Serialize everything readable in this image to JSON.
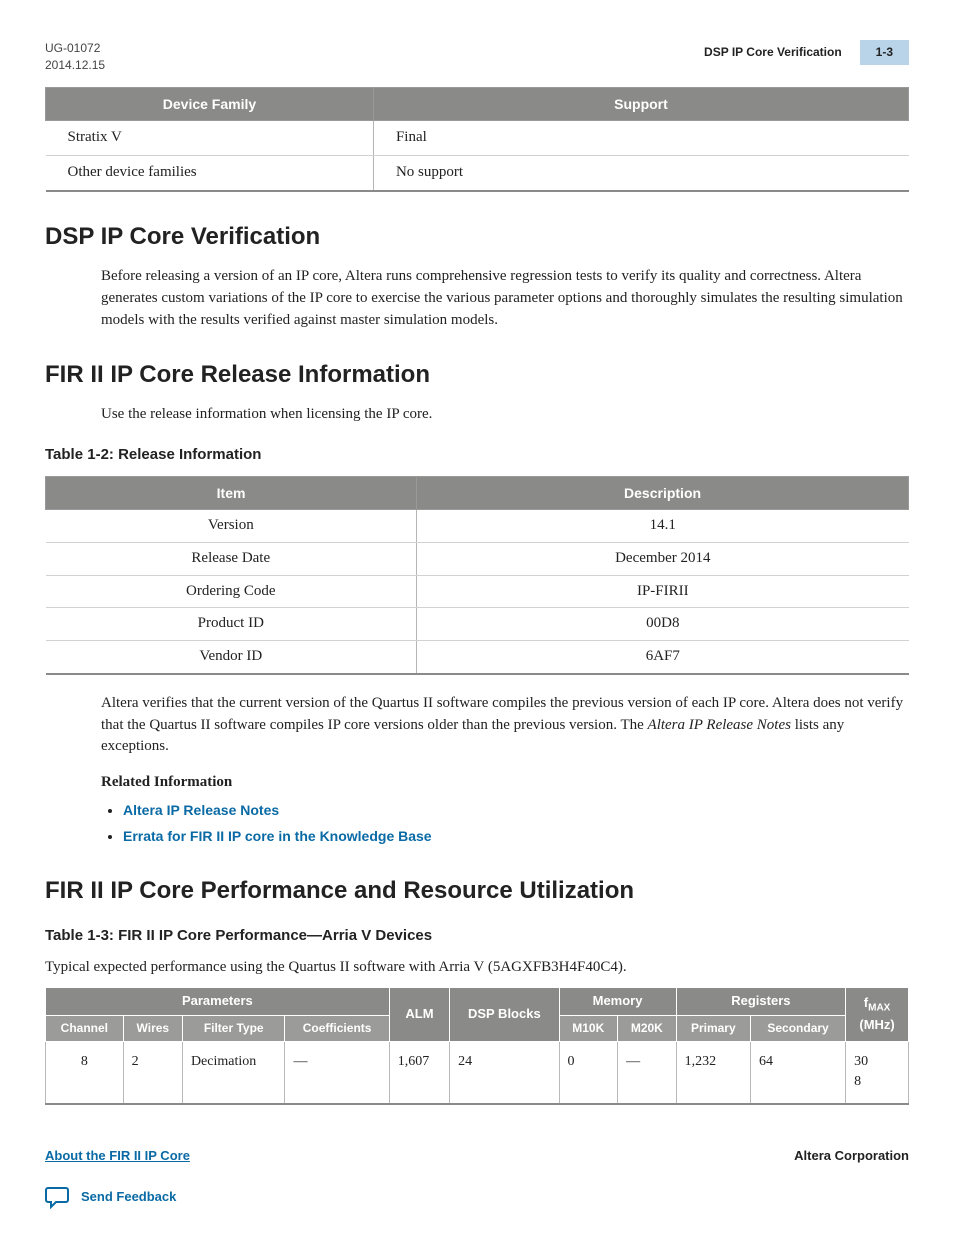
{
  "header": {
    "doc_id": "UG-01072",
    "date": "2014.12.15",
    "running_title": "DSP IP Core Verification",
    "page_num": "1-3"
  },
  "device_support_table": {
    "headers": [
      "Device Family",
      "Support"
    ],
    "rows": [
      {
        "family": "Stratix V",
        "support": "Final"
      },
      {
        "family": "Other device families",
        "support": "No support"
      }
    ]
  },
  "sections": {
    "verification": {
      "title": "DSP IP Core Verification",
      "body": "Before releasing a version of an IP core, Altera runs comprehensive regression tests to verify its quality and correctness. Altera generates custom variations of the IP core to exercise the various parameter options and thoroughly simulates the resulting simulation models with the results verified against master simulation models."
    },
    "release": {
      "title": "FIR II IP Core Release Information",
      "intro": "Use the release information when licensing the IP core.",
      "caption": "Table 1-2: Release Information",
      "headers": [
        "Item",
        "Description"
      ],
      "rows": [
        {
          "item": "Version",
          "desc": "14.1"
        },
        {
          "item": "Release Date",
          "desc": "December 2014"
        },
        {
          "item": "Ordering Code",
          "desc": "IP-FIRII"
        },
        {
          "item": "Product ID",
          "desc": "00D8"
        },
        {
          "item": "Vendor ID",
          "desc": "6AF7"
        }
      ],
      "after_para_1": "Altera verifies that the current version of the Quartus II software compiles the previous version of each IP core. Altera does not verify that the Quartus II software compiles IP core versions older than the previous version. The ",
      "after_para_em": "Altera IP Release Notes",
      "after_para_2": " lists any exceptions.",
      "related_heading": "Related Information",
      "related_links": [
        "Altera IP Release Notes",
        "Errata for FIR II IP core in the Knowledge Base"
      ]
    },
    "performance": {
      "title": "FIR II IP Core Performance and Resource Utilization",
      "caption": "Table 1-3: FIR II IP Core Performance—Arria V Devices",
      "desc": "Typical expected performance using the Quartus II software with Arria V (5AGXFB3H4F40C4).",
      "group_headers": {
        "parameters": "Parameters",
        "alm": "ALM",
        "dsp": "DSP Blocks",
        "memory": "Memory",
        "registers": "Registers",
        "fmax_prefix": "f",
        "fmax_sub": "MAX",
        "fmax_unit": "(MHz)"
      },
      "sub_headers": {
        "channel": "Channel",
        "wires": "Wires",
        "filter_type": "Filter Type",
        "coefficients": "Coefficients",
        "m10k": "M10K",
        "m20k": "M20K",
        "primary": "Primary",
        "secondary": "Secondary"
      },
      "row": {
        "channel": "8",
        "wires": "2",
        "filter_type": "Decimation",
        "coefficients": "—",
        "alm": "1,607",
        "dsp": "24",
        "m10k": "0",
        "m20k": "—",
        "primary": "1,232",
        "secondary": "64",
        "fmax_a": "30",
        "fmax_b": "8"
      }
    }
  },
  "footer": {
    "left": "About the FIR II IP Core",
    "right": "Altera Corporation",
    "feedback": "Send Feedback"
  }
}
